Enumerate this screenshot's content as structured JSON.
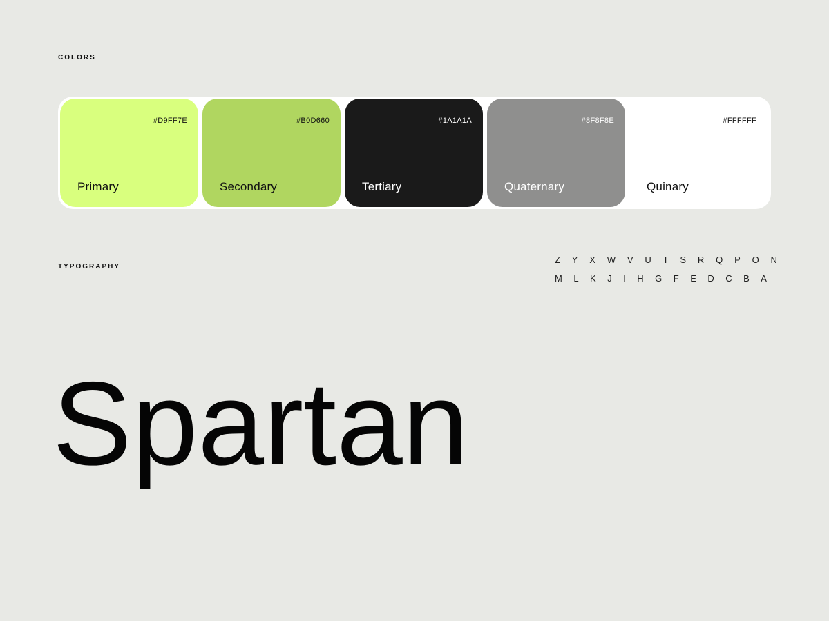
{
  "colors_section": {
    "label": "COLORS",
    "swatches": [
      {
        "name": "Primary",
        "hex": "#D9FF7E",
        "color": "#D9FF7E",
        "text_color": "#111111"
      },
      {
        "name": "Secondary",
        "hex": "#B0D660",
        "color": "#B0D660",
        "text_color": "#111111"
      },
      {
        "name": "Tertiary",
        "hex": "#1A1A1A",
        "color": "#1A1A1A",
        "text_color": "#FFFFFF"
      },
      {
        "name": "Quaternary",
        "hex": "#8F8F8E",
        "color": "#8F8F8E",
        "text_color": "#FFFFFF"
      },
      {
        "name": "Quinary",
        "hex": "#FFFFFF",
        "color": "#FFFFFF",
        "text_color": "#111111"
      }
    ]
  },
  "typography_section": {
    "label": "TYPOGRAPHY",
    "alphabet_row_1": [
      "Z",
      "Y",
      "X",
      "W",
      "V",
      "U",
      "T",
      "S",
      "R",
      "Q",
      "P",
      "O",
      "N"
    ],
    "alphabet_row_2": [
      "M",
      "L",
      "K",
      "J",
      "I",
      "H",
      "G",
      "F",
      "E",
      "D",
      "C",
      "B",
      "A"
    ],
    "specimen": "Spartan"
  },
  "theme": {
    "background": "#E8E9E5",
    "palette_background": "#FFFFFF"
  }
}
